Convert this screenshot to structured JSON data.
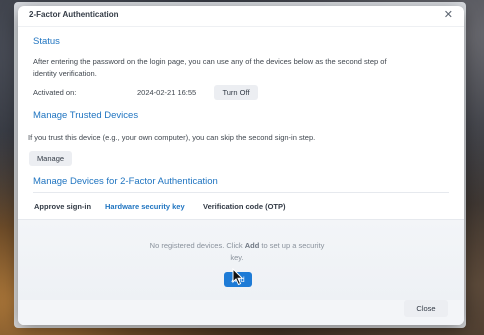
{
  "dialog": {
    "title": "2-Factor Authentication",
    "close_icon": "close-icon"
  },
  "status": {
    "heading": "Status",
    "description_line1": "After entering the password on the login page, you can use any of the devices below as the second step of",
    "description_line2": "identity verification.",
    "activated_label": "Activated on:",
    "activated_value": "2024-02-21 16:55",
    "turn_off_label": "Turn Off"
  },
  "trusted": {
    "heading": "Manage Trusted Devices",
    "description": "If you trust this device (e.g., your own computer), you can skip the second sign-in step.",
    "manage_label": "Manage"
  },
  "devices": {
    "heading": "Manage Devices for 2-Factor Authentication",
    "tabs": [
      {
        "label": "Approve sign-in",
        "active": false
      },
      {
        "label": "Hardware security key",
        "active": true
      },
      {
        "label": "Verification code (OTP)",
        "active": false
      }
    ],
    "empty_prefix": "No registered devices. Click ",
    "empty_bold": "Add",
    "empty_suffix": " to set up a security key.",
    "add_label": "Add"
  },
  "footer": {
    "close_label": "Close"
  },
  "colors": {
    "accent": "#1f74c0",
    "primary_button": "#1e7bd6"
  }
}
